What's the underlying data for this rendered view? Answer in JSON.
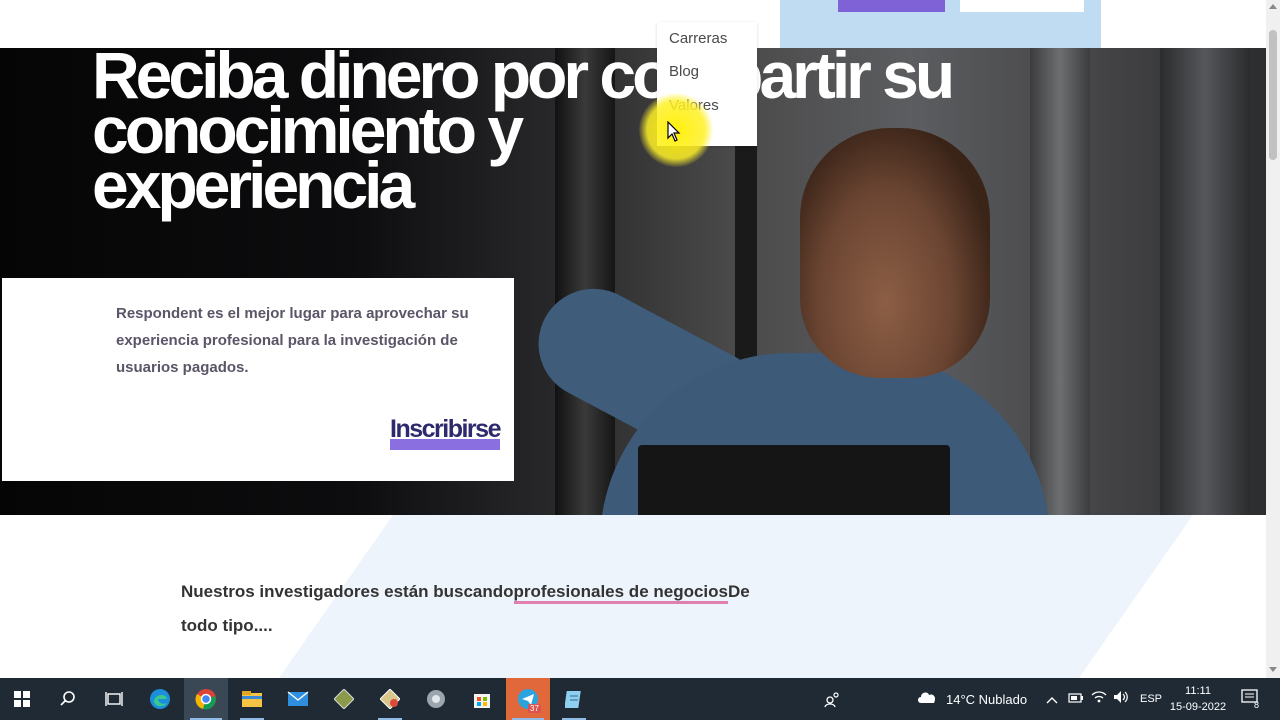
{
  "nav_dropdown": {
    "items": [
      {
        "label": "Carreras"
      },
      {
        "label": "Blog"
      },
      {
        "label": "Valores"
      }
    ]
  },
  "hero": {
    "title_line1": "Reciba dinero por compartir su",
    "title_line2": "conocimiento y",
    "title_line3": "experiencia",
    "description": "Respondent es el mejor lugar para aprovechar su experiencia profesional para la investigación de usuarios pagados.",
    "cta_label": "Inscribirse"
  },
  "section": {
    "text_before": "Nuestros investigadores están buscando",
    "highlight": "profesionales de negocios",
    "text_after": "De todo tipo...."
  },
  "taskbar": {
    "weather": "14°C  Nublado",
    "language": "ESP",
    "time": "11:11",
    "date": "15-09-2022",
    "notification_count": "8",
    "telegram_badge": "37",
    "icons": [
      "windows-start-icon",
      "search-icon",
      "task-view-icon",
      "edge-icon",
      "chrome-icon",
      "file-explorer-icon",
      "mail-icon",
      "app-icon",
      "app-icon-2",
      "app-icon-3",
      "store-icon",
      "telegram-icon",
      "notepad-icon"
    ]
  },
  "colors": {
    "accent_purple": "#8a6fe0",
    "link_pink": "#e07fb0",
    "taskbar": "#1f2a35"
  }
}
